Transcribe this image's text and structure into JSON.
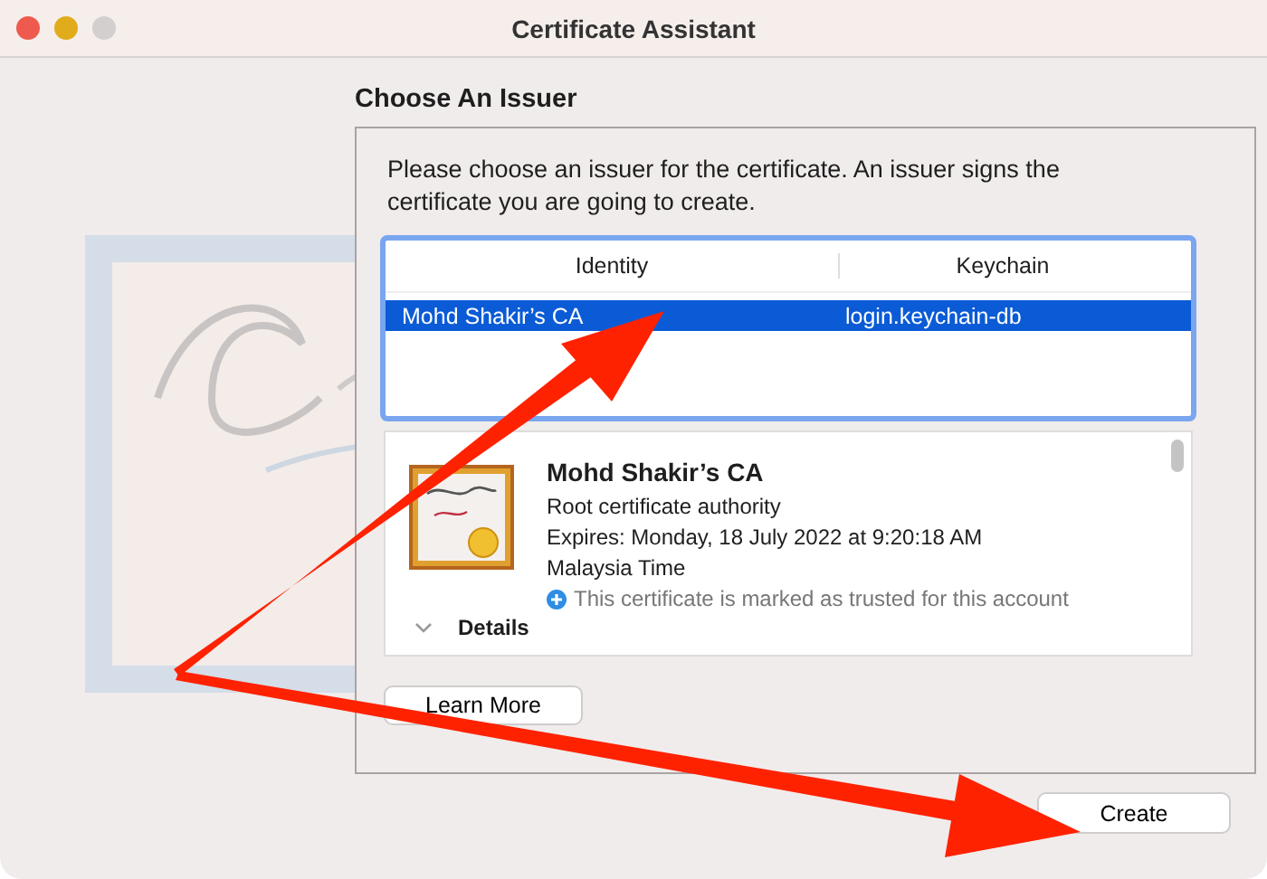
{
  "window": {
    "title": "Certificate Assistant"
  },
  "heading": "Choose An Issuer",
  "instructions": "Please choose an issuer for the certificate. An issuer signs the certificate you are going to create.",
  "table": {
    "columns": [
      "Identity",
      "Keychain"
    ],
    "rows": [
      {
        "identity": "Mohd Shakir’s CA",
        "keychain": "login.keychain-db",
        "selected": true
      }
    ]
  },
  "certificate": {
    "name": "Mohd Shakir’s CA",
    "type": "Root certificate authority",
    "expires": "Expires: Monday, 18 July 2022 at 9:20:18 AM Malaysia Time",
    "trust": "This certificate is marked as trusted for this account",
    "details_label": "Details"
  },
  "learn_more_button": "Learn More",
  "create_button": "Create"
}
